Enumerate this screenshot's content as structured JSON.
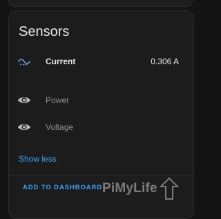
{
  "card": {
    "title": "Sensors"
  },
  "sensors": [
    {
      "label": "Current",
      "value": "0.306 A",
      "icon": "current-ac-icon"
    },
    {
      "label": "Power",
      "icon": "eye-icon"
    },
    {
      "label": "Voltage",
      "icon": "eye-icon"
    }
  ],
  "actions": {
    "show_less": "Show less",
    "add_to_dashboard": "ADD TO DASHBOARD"
  },
  "watermark": {
    "text": "PiMyLife",
    "suffix": "Up"
  },
  "colors": {
    "accent": "#3da4f5",
    "icon_current": "#6f8fd4",
    "background": "#141414",
    "card": "#1c1c1c"
  }
}
